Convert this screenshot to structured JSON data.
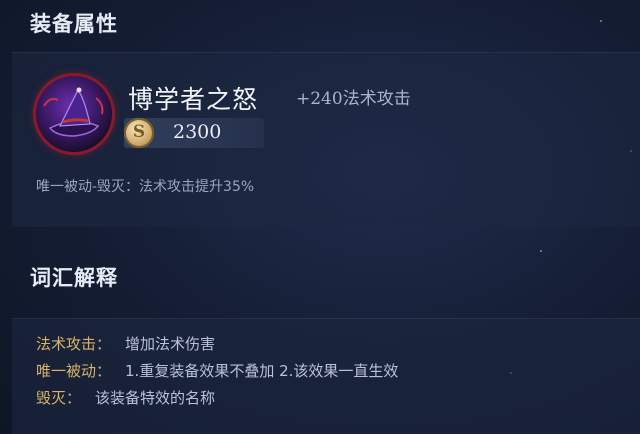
{
  "sections": {
    "equipment_title": "装备属性",
    "glossary_title": "词汇解释"
  },
  "item": {
    "icon": "wizard-hat-icon",
    "name": "博学者之怒",
    "bonus": "+240法术攻击",
    "currency_icon": "gold-coin-icon",
    "coin_letter": "S",
    "price": "2300",
    "passive": "唯一被动-毁灭：法术攻击提升35%"
  },
  "glossary": [
    {
      "term": "法术攻击：",
      "desc": "增加法术伤害"
    },
    {
      "term": "唯一被动：",
      "desc": "1.重复装备效果不叠加 2.该效果一直生效"
    },
    {
      "term": "毁灭：",
      "desc": "该装备特效的名称"
    }
  ],
  "colors": {
    "background": "#141d33",
    "glossary_term": "#d8b36a",
    "icon_border": "#8a1a2a"
  }
}
